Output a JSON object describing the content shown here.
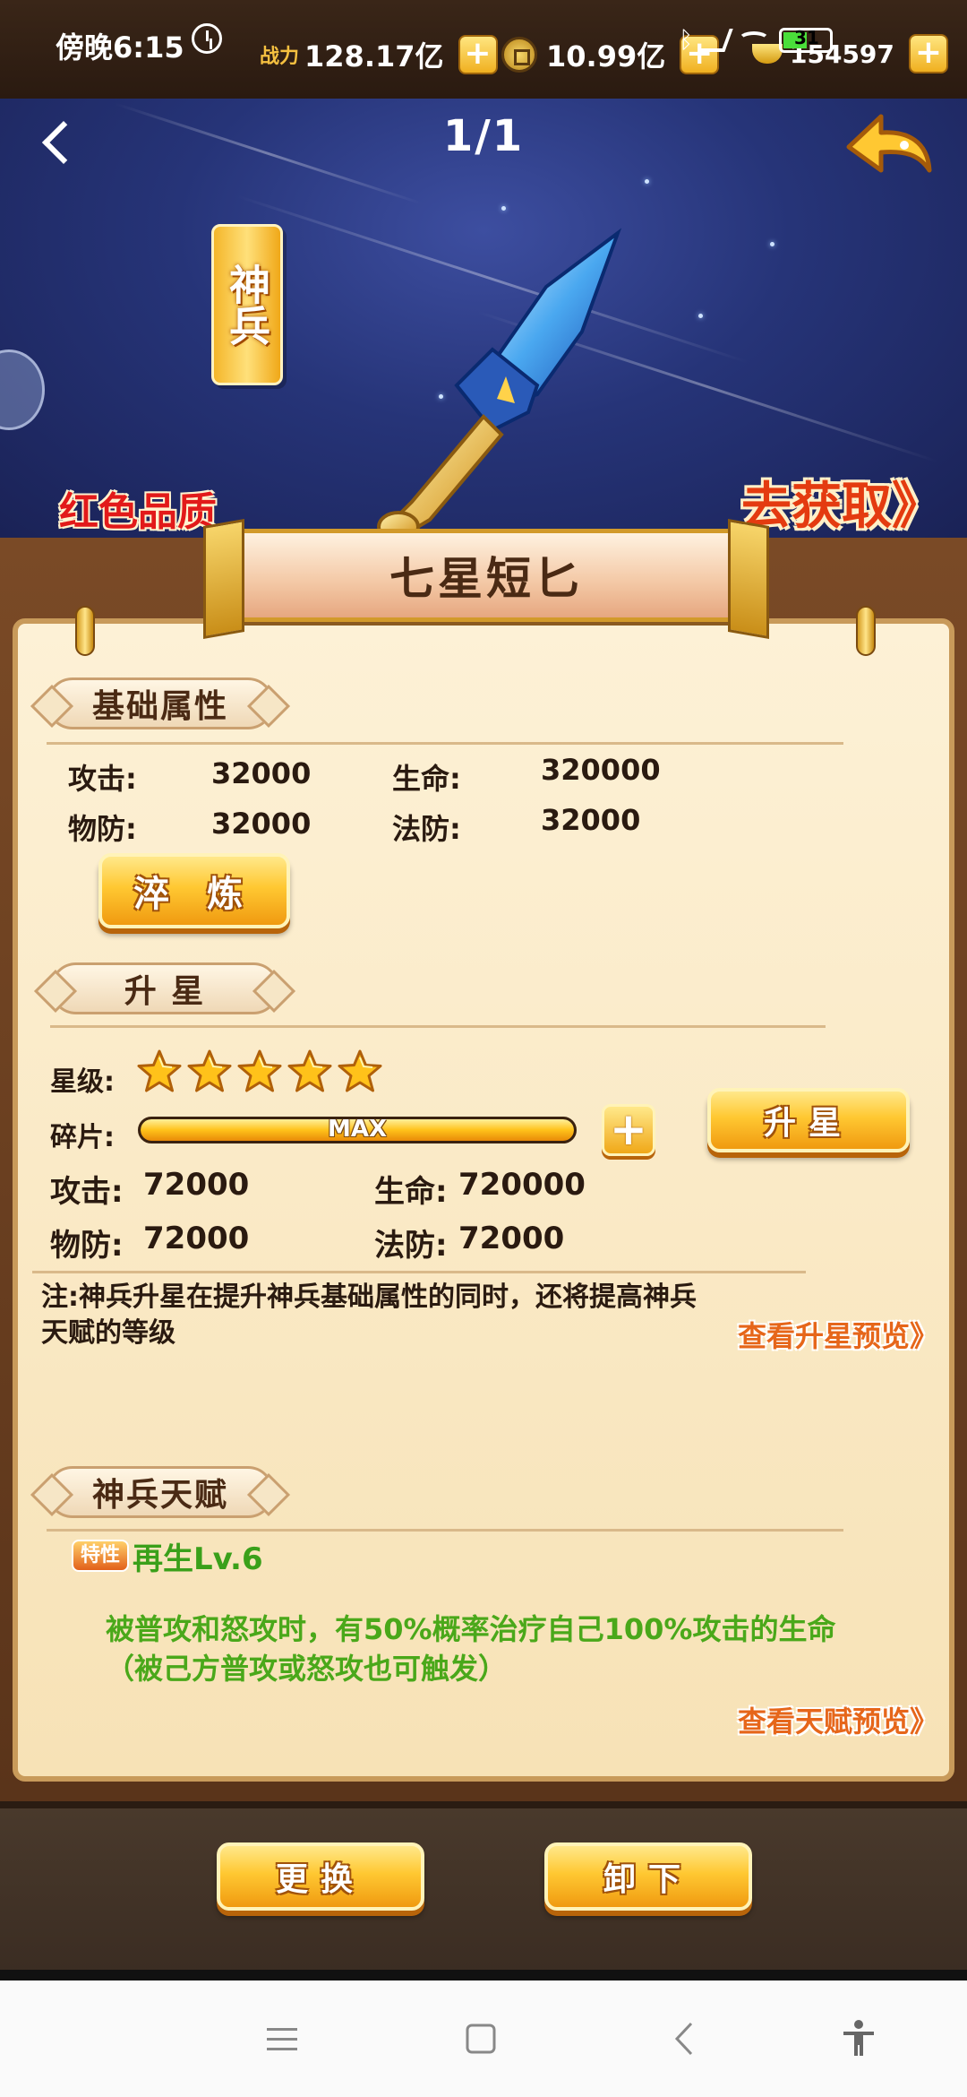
{
  "status_bar": {
    "time": "傍晚6:15",
    "power_label": "战力",
    "power_value": "128.17亿",
    "coin_value": "10.99亿",
    "ingot_value": "154597",
    "battery": "31"
  },
  "hero": {
    "page_indicator": "1/1",
    "type_tag": "神兵",
    "quality": "红色品质",
    "obtain_link": "去获取》"
  },
  "item": {
    "name": "七星短匕"
  },
  "basic_attributes": {
    "header": "基础属性",
    "rows": [
      {
        "label1": "攻击:",
        "value1": "32000",
        "label2": "生命:",
        "value2": "320000"
      },
      {
        "label1": "物防:",
        "value1": "32000",
        "label2": "法防:",
        "value2": "32000"
      }
    ],
    "refine_button": "淬 炼"
  },
  "star_up": {
    "header": "升 星",
    "star_level_label": "星级:",
    "star_count": 5,
    "fragment_label": "碎片:",
    "fragment_progress": 1.0,
    "fragment_text": "MAX",
    "plus_label": "+",
    "star_up_button": "升星",
    "rows": [
      {
        "label1": "攻击:",
        "value1": "72000",
        "label2": "生命:",
        "value2": "720000"
      },
      {
        "label1": "物防:",
        "value1": "72000",
        "label2": "法防:",
        "value2": "72000"
      }
    ],
    "note": "注:神兵升星在提升神兵基础属性的同时，还将提高神兵天赋的等级",
    "preview_link": "查看升星预览》"
  },
  "talent": {
    "header": "神兵天赋",
    "trait_badge": "特性",
    "trait_name": "再生Lv.6",
    "description": "被普攻和怒攻时，有50%概率治疗自己100%攻击的生命（被己方普攻或怒攻也可触发）",
    "preview_link": "查看天赋预览》"
  },
  "actions": {
    "replace_button": "更换",
    "unequip_button": "卸下"
  },
  "colors": {
    "accent_gold": "#ffc832",
    "quality_red": "#e21a1a",
    "talent_green": "#4aa81a"
  }
}
